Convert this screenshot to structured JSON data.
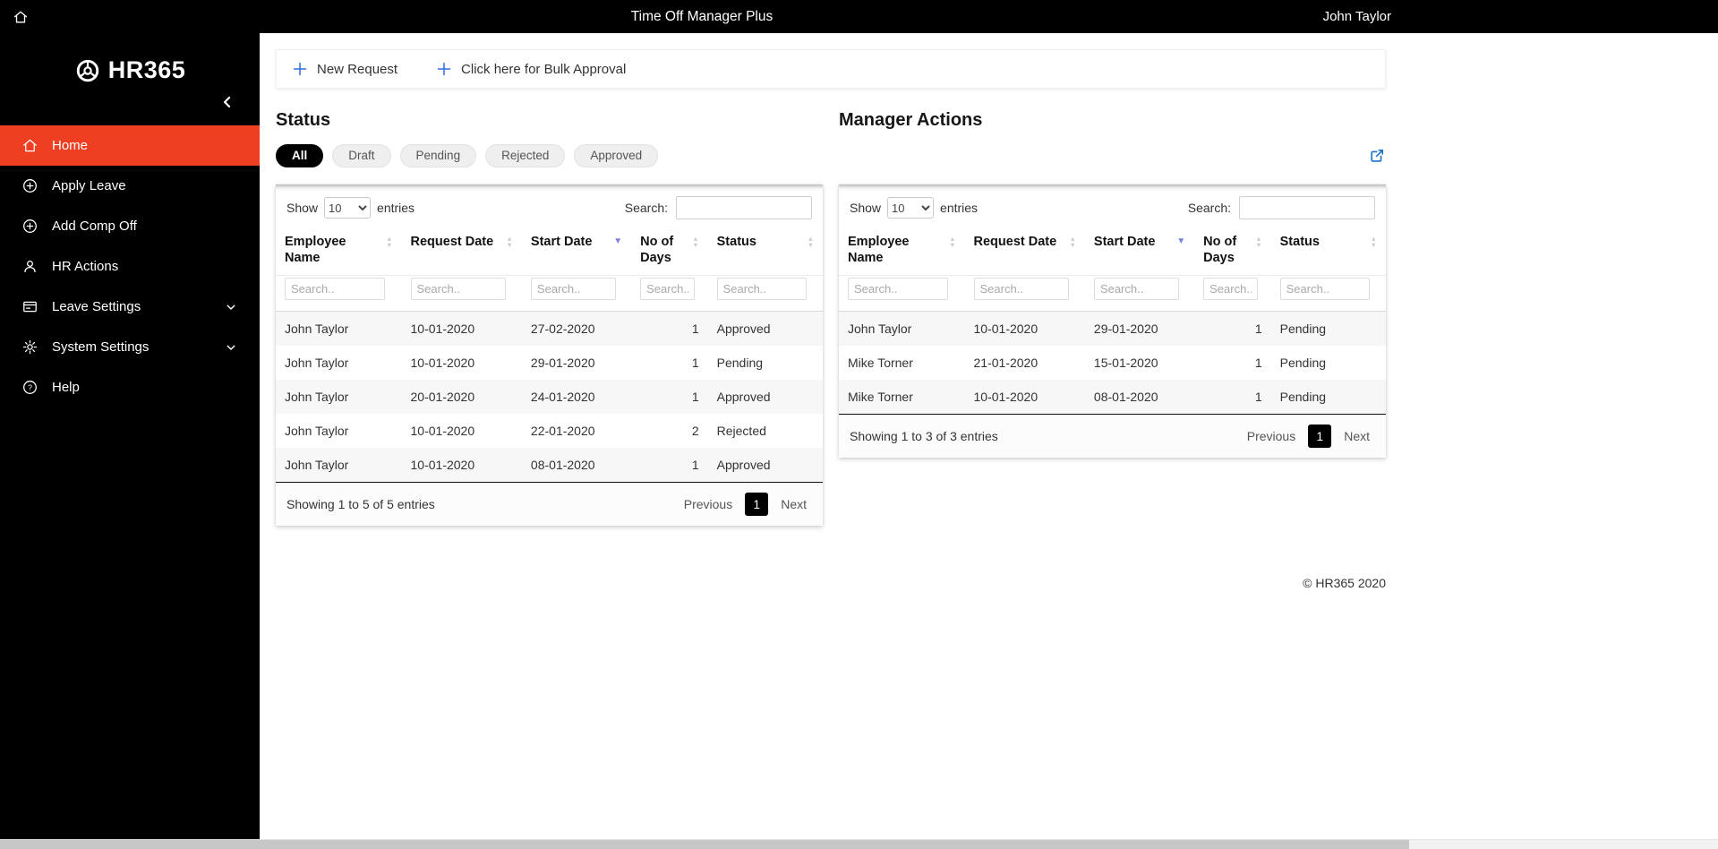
{
  "topbar": {
    "title": "Time Off Manager Plus",
    "user": "John Taylor"
  },
  "sidebar": {
    "logo_text": "HR365",
    "items": [
      {
        "label": "Home",
        "icon": "home-icon",
        "active": true
      },
      {
        "label": "Apply Leave",
        "icon": "plus-circle-icon"
      },
      {
        "label": "Add Comp Off",
        "icon": "plus-circle-icon"
      },
      {
        "label": "HR Actions",
        "icon": "person-icon"
      },
      {
        "label": "Leave Settings",
        "icon": "wallet-icon",
        "expandable": true
      },
      {
        "label": "System Settings",
        "icon": "gear-icon",
        "expandable": true
      },
      {
        "label": "Help",
        "icon": "help-icon"
      }
    ]
  },
  "toolbar": {
    "new_request": "New Request",
    "bulk_approval": "Click here for Bulk Approval"
  },
  "table_controls": {
    "show_label": "Show",
    "page_size": "10",
    "entries_label": "entries",
    "search_label": "Search:",
    "column_search_placeholder": "Search..",
    "previous_label": "Previous",
    "page": "1",
    "next_label": "Next"
  },
  "status_panel": {
    "title": "Status",
    "filters": [
      {
        "label": "All",
        "active": true
      },
      {
        "label": "Draft"
      },
      {
        "label": "Pending"
      },
      {
        "label": "Rejected"
      },
      {
        "label": "Approved"
      }
    ],
    "table": {
      "columns": [
        "Employee Name",
        "Request Date",
        "Start Date",
        "No of Days",
        "Status"
      ],
      "sorted_column": "Start Date",
      "rows": [
        {
          "employee_name": "John Taylor",
          "request_date": "10-01-2020",
          "start_date": "27-02-2020",
          "no_of_days": "1",
          "status": "Approved"
        },
        {
          "employee_name": "John Taylor",
          "request_date": "10-01-2020",
          "start_date": "29-01-2020",
          "no_of_days": "1",
          "status": "Pending"
        },
        {
          "employee_name": "John Taylor",
          "request_date": "20-01-2020",
          "start_date": "24-01-2020",
          "no_of_days": "1",
          "status": "Approved"
        },
        {
          "employee_name": "John Taylor",
          "request_date": "10-01-2020",
          "start_date": "22-01-2020",
          "no_of_days": "2",
          "status": "Rejected"
        },
        {
          "employee_name": "John Taylor",
          "request_date": "10-01-2020",
          "start_date": "08-01-2020",
          "no_of_days": "1",
          "status": "Approved"
        }
      ],
      "info": "Showing 1 to 5 of 5 entries"
    }
  },
  "manager_panel": {
    "title": "Manager Actions",
    "table": {
      "columns": [
        "Employee Name",
        "Request Date",
        "Start Date",
        "No of Days",
        "Status"
      ],
      "sorted_column": "Start Date",
      "rows": [
        {
          "employee_name": "John Taylor",
          "request_date": "10-01-2020",
          "start_date": "29-01-2020",
          "no_of_days": "1",
          "status": "Pending"
        },
        {
          "employee_name": "Mike Torner",
          "request_date": "21-01-2020",
          "start_date": "15-01-2020",
          "no_of_days": "1",
          "status": "Pending"
        },
        {
          "employee_name": "Mike Torner",
          "request_date": "10-01-2020",
          "start_date": "08-01-2020",
          "no_of_days": "1",
          "status": "Pending"
        }
      ],
      "info": "Showing 1 to 3 of 3 entries"
    }
  },
  "footer": {
    "copyright": "© HR365 2020"
  },
  "colors": {
    "active_nav": "#ee3f23",
    "accent_blue": "#2e6fdb",
    "external_link_blue": "#1a6fc7",
    "approved": "#28a745",
    "pending": "#efb10e",
    "rejected": "#e8323e",
    "active_page": "#000000"
  }
}
